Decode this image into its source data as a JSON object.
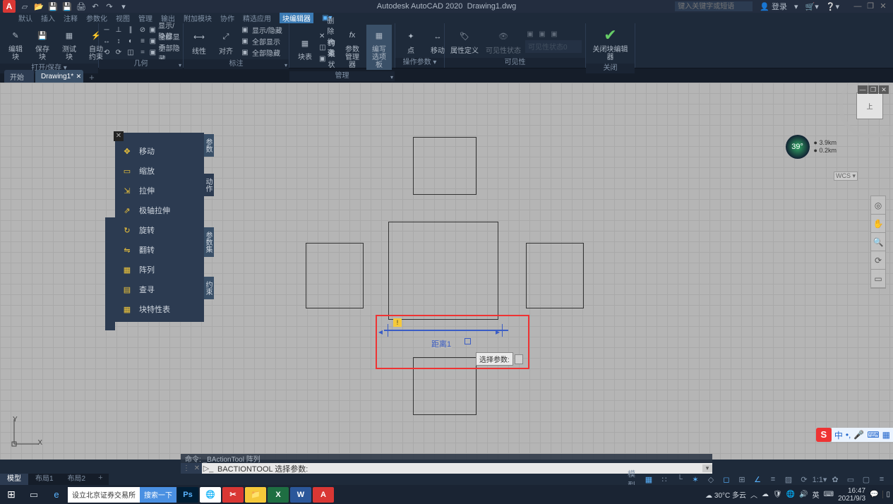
{
  "app": {
    "title_prefix": "Autodesk AutoCAD 2020",
    "doc": "Drawing1.dwg"
  },
  "qat_search_placeholder": "键入关键字或短语",
  "qat_user": "登录",
  "menu": [
    "默认",
    "插入",
    "注释",
    "参数化",
    "视图",
    "管理",
    "输出",
    "附加模块",
    "协作",
    "精选应用",
    "块编辑器"
  ],
  "menu_active_index": 10,
  "ribbon": {
    "g0": {
      "label": "打开/保存 ▾",
      "b0": "编辑块",
      "b1": "保存块",
      "b2": "测试块",
      "b3": "自动约束"
    },
    "g1": {
      "label": "几何",
      "r0": "显示/隐藏",
      "r1": "全部显示",
      "r2": "全部隐藏"
    },
    "g2": {
      "label": "标注",
      "b0": "线性",
      "b1": "对齐",
      "r0": "显示/隐藏",
      "r1": "全部显示",
      "r2": "全部隐藏"
    },
    "g3": {
      "label": "管理",
      "b0": "块表",
      "r0": "删除约束",
      "r1": "构造",
      "r2": "约束状态",
      "b1": "参数管理器",
      "b2": "编写选项板"
    },
    "g4": {
      "label": "操作参数 ▾",
      "b0": "点",
      "b1": "移动"
    },
    "g5": {
      "label": "可见性",
      "b0": "属性定义",
      "b1": "可见性状态",
      "dd": "可见性状态0"
    },
    "g6": {
      "label": "关闭",
      "b0": "关闭块编辑器"
    }
  },
  "filetabs": {
    "t0": "开始",
    "t1": "Drawing1*"
  },
  "palette": {
    "items": [
      "移动",
      "缩放",
      "拉伸",
      "极轴拉伸",
      "旋转",
      "翻转",
      "阵列",
      "查寻",
      "块特性表"
    ],
    "side0": "参数",
    "side1": "动作",
    "side2": "参数集",
    "side3": "约束"
  },
  "canvas": {
    "dim_label": "距离1",
    "prompt": "选择参数:",
    "warn": "!",
    "ucs_x": "X",
    "ucs_y": "Y",
    "viewcube": "上",
    "wcs": "WCS ▾",
    "gage_val": "39°",
    "gage_line1": "3.9km",
    "gage_line2": "0.2km"
  },
  "cmd": {
    "history": "命令: _BActionTool 阵列",
    "current": "BACTIONTOOL 选择参数:"
  },
  "layout_tabs": [
    "模型",
    "布局1",
    "布局2"
  ],
  "status_label": "模型",
  "taskbar": {
    "search_text": "设立北京证券交易所",
    "search_btn": "搜索一下",
    "weather": "30°C 多云",
    "ime": "英",
    "time": "16:47",
    "date": "2021/9/3"
  }
}
